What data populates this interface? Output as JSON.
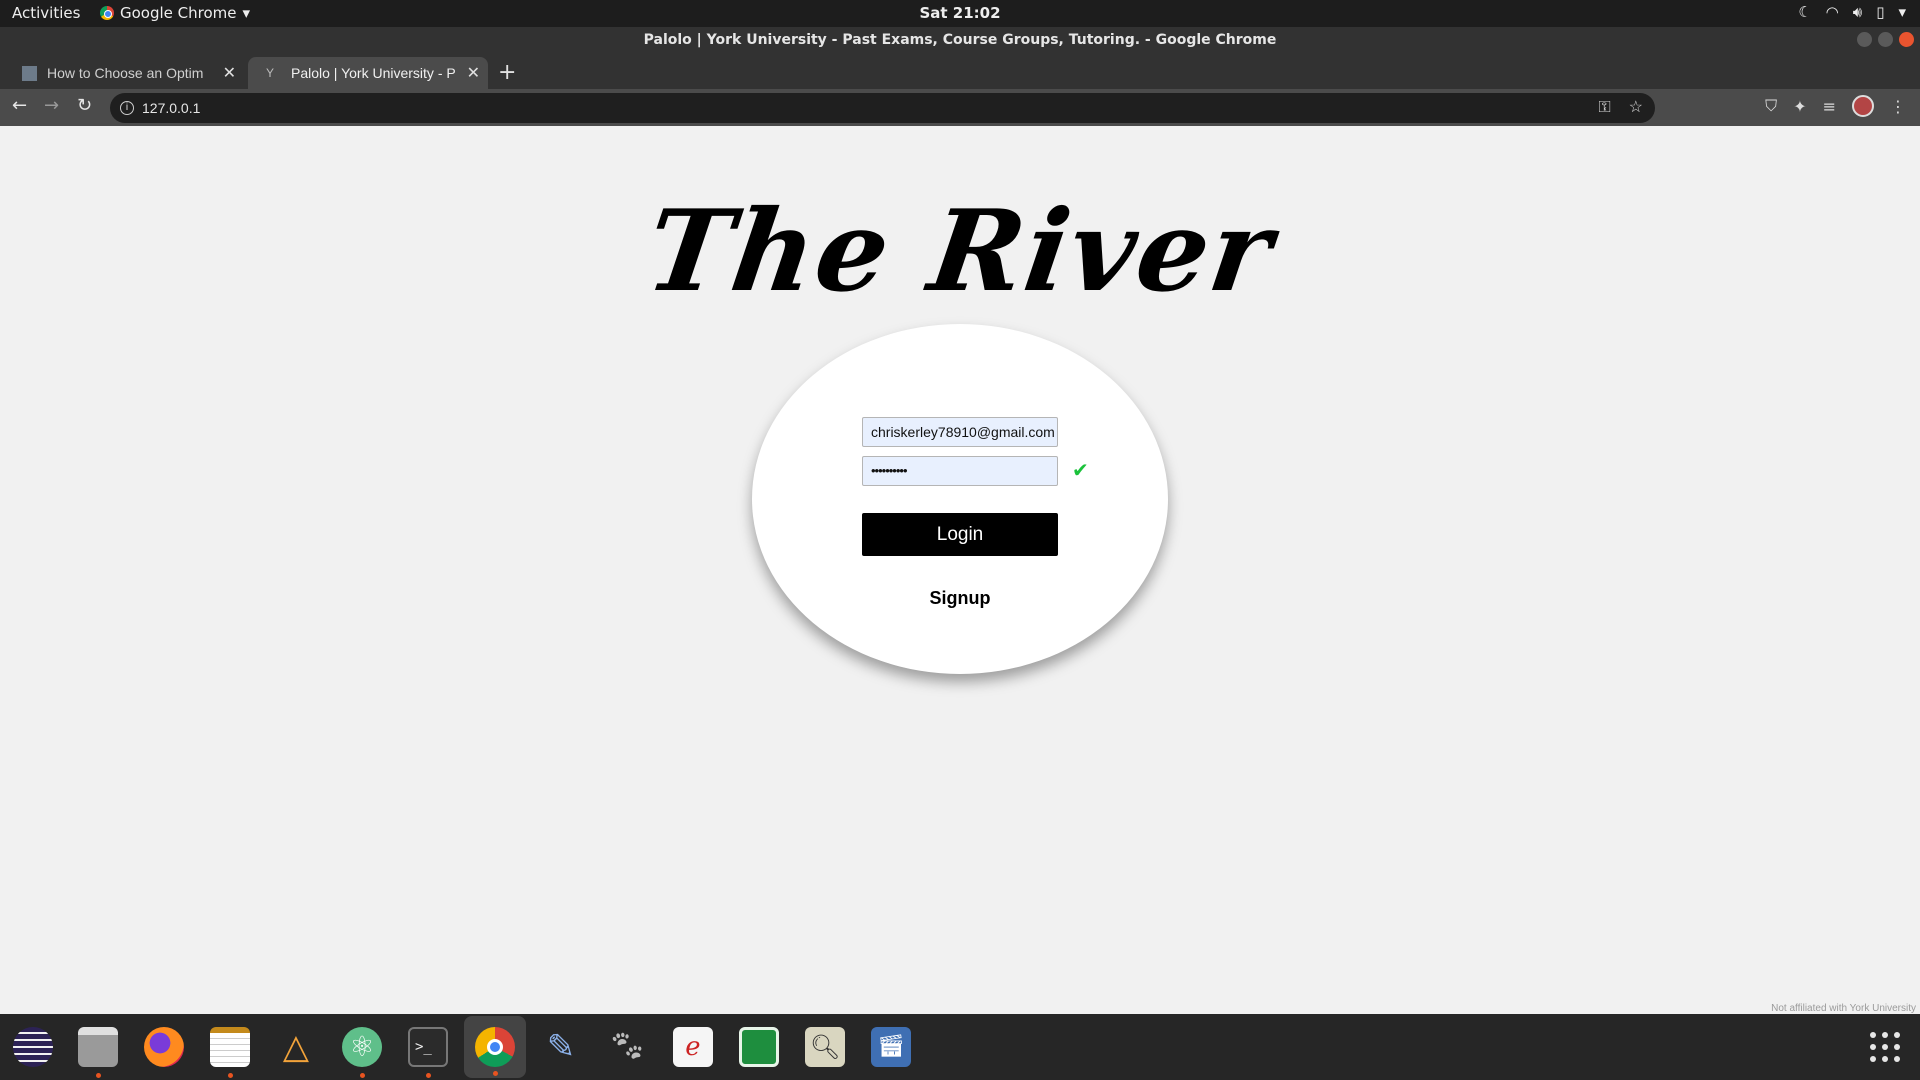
{
  "topbar": {
    "activities": "Activities",
    "app_name": "Google Chrome",
    "clock": "Sat 21:02"
  },
  "window": {
    "title": "Palolo | York University - Past Exams, Course Groups, Tutoring. - Google Chrome"
  },
  "tabs": [
    {
      "title": "How to Choose an Optim",
      "active": false
    },
    {
      "title": "Palolo | York University - P",
      "active": true
    }
  ],
  "omnibox": {
    "url": "127.0.0.1"
  },
  "page": {
    "logo": "The River",
    "email_value": "chriskerley78910@gmail.com",
    "password_mask": "••••••••••",
    "login_label": "Login",
    "signup_label": "Signup",
    "footer_note": "Not affiliated with York University"
  },
  "colors": {
    "login_bg": "#000000",
    "check": "#1bc23b",
    "autofill_bg": "#e8f0fe"
  }
}
